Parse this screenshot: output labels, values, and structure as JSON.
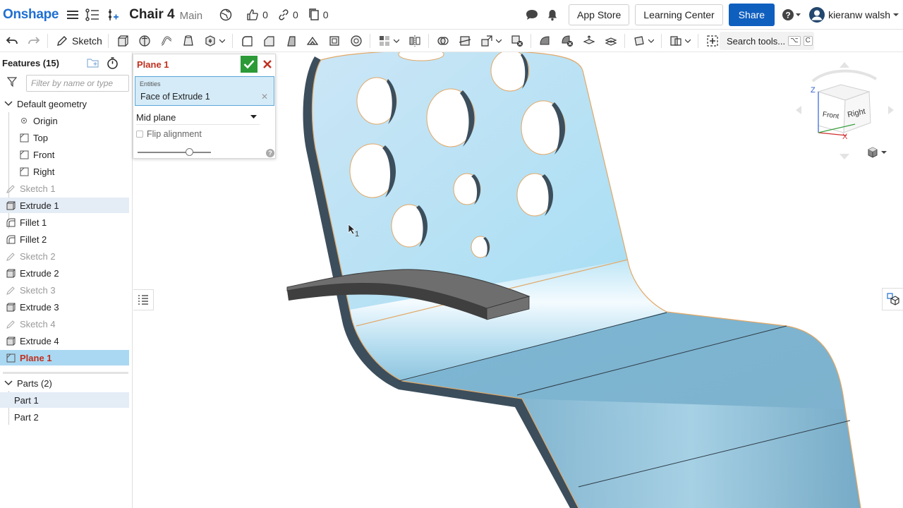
{
  "topbar": {
    "logo": "Onshape",
    "document_title": "Chair 4",
    "branch": "Main",
    "likes": "0",
    "links": "0",
    "copies": "0",
    "app_store": "App Store",
    "learning_center": "Learning Center",
    "share": "Share",
    "user": "kieranw walsh"
  },
  "toolbar": {
    "sketch_label": "Sketch",
    "search_placeholder": "Search tools...",
    "search_shortcut": [
      "⌥",
      "C"
    ]
  },
  "features": {
    "header": "Features (15)",
    "filter_placeholder": "Filter by name or type",
    "default_geometry": "Default geometry",
    "origin": "Origin",
    "planes": [
      "Top",
      "Front",
      "Right"
    ],
    "items": [
      {
        "label": "Sketch 1",
        "icon": "sketch-icon",
        "state": "dim"
      },
      {
        "label": "Extrude 1",
        "icon": "extrude-icon",
        "state": "selected"
      },
      {
        "label": "Fillet 1",
        "icon": "fillet-icon",
        "state": "normal"
      },
      {
        "label": "Fillet 2",
        "icon": "fillet-icon",
        "state": "normal"
      },
      {
        "label": "Sketch 2",
        "icon": "sketch-icon",
        "state": "dim"
      },
      {
        "label": "Extrude 2",
        "icon": "extrude-icon",
        "state": "normal"
      },
      {
        "label": "Sketch 3",
        "icon": "sketch-icon",
        "state": "dim"
      },
      {
        "label": "Extrude 3",
        "icon": "extrude-icon",
        "state": "normal"
      },
      {
        "label": "Sketch 4",
        "icon": "sketch-icon",
        "state": "dim"
      },
      {
        "label": "Extrude 4",
        "icon": "extrude-icon",
        "state": "normal"
      },
      {
        "label": "Plane 1",
        "icon": "plane-icon",
        "state": "active"
      }
    ],
    "parts_header": "Parts (2)",
    "parts": [
      "Part 1",
      "Part 2"
    ]
  },
  "plane_dialog": {
    "title": "Plane 1",
    "entities_label": "Entities",
    "entity_value": "Face of Extrude 1",
    "type_value": "Mid plane",
    "flip_alignment": "Flip alignment",
    "flip_checked": false,
    "slider_value": 0.7
  },
  "viewport": {
    "cursor_index": "1",
    "view_cube": {
      "front": "Front",
      "right": "Right",
      "z": "Z",
      "x": "X"
    }
  },
  "colors": {
    "brand": "#1f6fd1",
    "share": "#0f5fbf",
    "active_feature_text": "#c0301f",
    "active_feature_bg": "#aad8f2",
    "ok_green": "#2c9a37",
    "part_face": "#9fd2ec",
    "part_edge": "#3c4e5c"
  }
}
